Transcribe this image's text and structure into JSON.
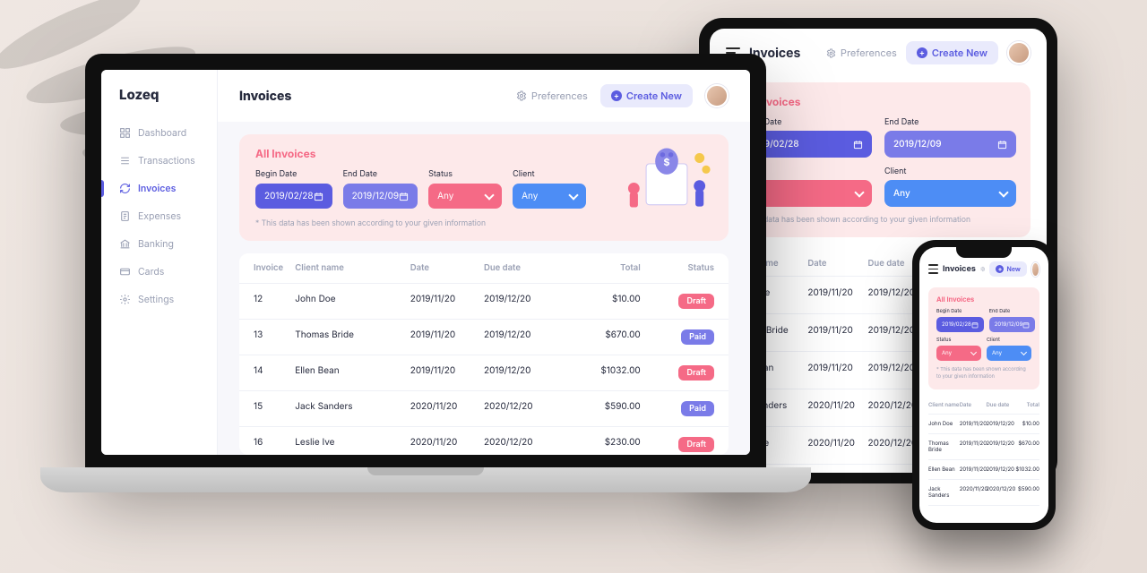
{
  "app": {
    "name": "Lozeq",
    "page_title": "Invoices"
  },
  "header": {
    "preferences": "Preferences",
    "create_new": "Create New",
    "create_new_short": "New"
  },
  "sidebar": {
    "items": [
      {
        "label": "Dashboard",
        "icon": "grid-icon"
      },
      {
        "label": "Transactions",
        "icon": "list-icon"
      },
      {
        "label": "Invoices",
        "icon": "refresh-icon",
        "active": true
      },
      {
        "label": "Expenses",
        "icon": "receipt-icon"
      },
      {
        "label": "Banking",
        "icon": "bank-icon"
      },
      {
        "label": "Cards",
        "icon": "card-icon"
      },
      {
        "label": "Settings",
        "icon": "gear-icon"
      }
    ]
  },
  "filter": {
    "title": "All Invoices",
    "begin_label": "Begin Date",
    "begin_value": "2019/02/28",
    "end_label": "End Date",
    "end_value": "2019/12/09",
    "status_label": "Status",
    "status_value": "Any",
    "client_label": "Client",
    "client_value": "Any",
    "note": "* This data has been shown according to your given information"
  },
  "table": {
    "columns": {
      "invoice": "Invoice",
      "client_name": "Client name",
      "date": "Date",
      "due_date": "Due date",
      "total": "Total",
      "status": "Status"
    },
    "rows": [
      {
        "invoice": "12",
        "name": "John Doe",
        "date": "2019/11/20",
        "due": "2019/12/20",
        "total": "$10.00",
        "status": "Draft"
      },
      {
        "invoice": "13",
        "name": "Thomas Bride",
        "date": "2019/11/20",
        "due": "2019/12/20",
        "total": "$670.00",
        "status": "Paid"
      },
      {
        "invoice": "14",
        "name": "Ellen Bean",
        "date": "2019/11/20",
        "due": "2019/12/20",
        "total": "$1032.00",
        "status": "Draft"
      },
      {
        "invoice": "15",
        "name": "Jack Sanders",
        "date": "2020/11/20",
        "due": "2020/12/20",
        "total": "$590.00",
        "status": "Paid"
      },
      {
        "invoice": "16",
        "name": "Leslie Ive",
        "date": "2020/11/20",
        "due": "2020/12/20",
        "total": "$230.00",
        "status": "Draft"
      }
    ]
  },
  "tablet_rows_visible": [
    "John Doe",
    "Thomas Bride",
    "Ellen Bean",
    "Jack Sanders",
    "Leslie Ive"
  ],
  "phone_rows_visible": [
    "John Doe",
    "Thomas Bride",
    "Ellen Bean",
    "Jack Sanders"
  ],
  "status_map": {
    "Draft": "draft",
    "Paid": "paid"
  }
}
